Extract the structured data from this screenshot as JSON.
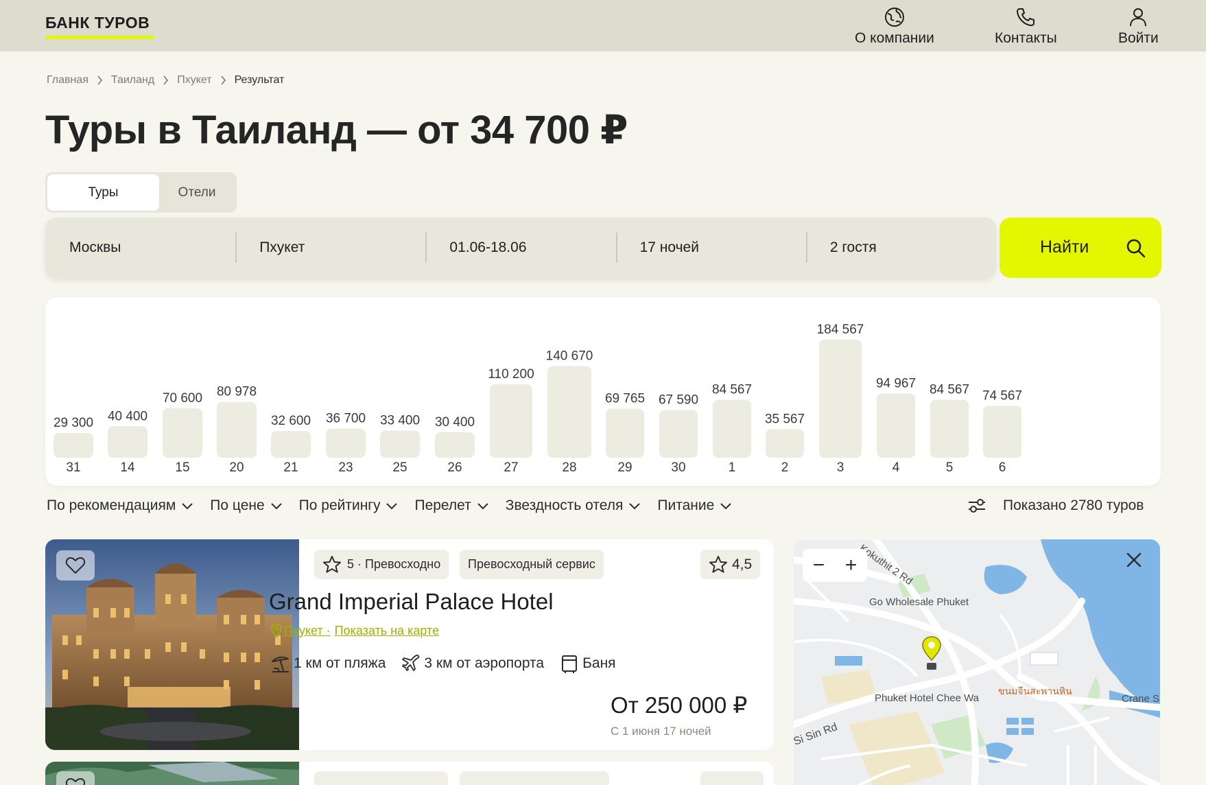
{
  "header": {
    "logo": "БАНК ТУРОВ",
    "nav": [
      {
        "label": "О компании",
        "icon": "globe-icon"
      },
      {
        "label": "Контакты",
        "icon": "phone-icon"
      },
      {
        "label": "Войти",
        "icon": "user-icon"
      }
    ]
  },
  "breadcrumb": [
    "Главная",
    "Таиланд",
    "Пхукет",
    "Результат"
  ],
  "page_title": "Туры в Таиланд — от 34 700 ₽",
  "tabs": [
    {
      "label": "Туры",
      "active": true
    },
    {
      "label": "Отели",
      "active": false
    }
  ],
  "search": {
    "from": "Москвы",
    "to": "Пхукет",
    "dates": "01.06-18.06",
    "nights": "17 ночей",
    "guests": "2 гостя",
    "button": "Найти"
  },
  "chart_data": {
    "type": "bar",
    "categories": [
      "31",
      "14",
      "15",
      "20",
      "21",
      "23",
      "25",
      "26",
      "27",
      "28",
      "29",
      "30",
      "1",
      "2",
      "3",
      "4",
      "5",
      "6"
    ],
    "values": [
      29300,
      40400,
      70600,
      80978,
      32600,
      36700,
      33400,
      30400,
      110200,
      140670,
      69765,
      67590,
      84567,
      35567,
      184567,
      94967,
      84567,
      74567
    ],
    "labels": [
      "29 300",
      "40 400",
      "70 600",
      "80 978",
      "32 600",
      "36 700",
      "33 400",
      "30 400",
      "110 200",
      "140 670",
      "69 765",
      "67 590",
      "84 567",
      "35 567",
      "184 567",
      "94 967",
      "84 567",
      "74 567"
    ],
    "bar_color": "#ecece1"
  },
  "filters": [
    "По рекомендациям",
    "По цене",
    "По рейтингу",
    "Перелет",
    "Звездность отеля",
    "Питание"
  ],
  "shown_text": "Показано 2780 туров",
  "hotel": {
    "stars_text": "5 · Превосходно",
    "service_badge": "Превосходный сервис",
    "rating": "4,5",
    "name": "Grand Imperial Palace Hotel",
    "city": "Пхукет ·",
    "map_link": "Показать на карте",
    "amenities": [
      {
        "label": "1 км от пляжа",
        "icon": "beach-umbrella-icon"
      },
      {
        "label": "3 км от аэропорта",
        "icon": "airplane-icon"
      },
      {
        "label": "Баня",
        "icon": "sauna-icon"
      }
    ],
    "price": "От 250 000 ₽",
    "price_sub": "С 1 июня 17 ночей"
  },
  "map": {
    "labels": {
      "road1": "Kokuthit 2 Rd",
      "poi1": "Go Wholesale Phuket",
      "poi2": "Phuket Hotel Chee Wa",
      "poi3": "ขนมจีนสะพานหิน",
      "poi4": "Crane S",
      "road2": "Si Sin Rd"
    },
    "zoom_out": "−",
    "zoom_in": "+"
  },
  "colors": {
    "accent": "#e3f800",
    "header_bg": "#dcdccf",
    "page_bg": "#f6f6ef",
    "link": "#9fb000"
  }
}
